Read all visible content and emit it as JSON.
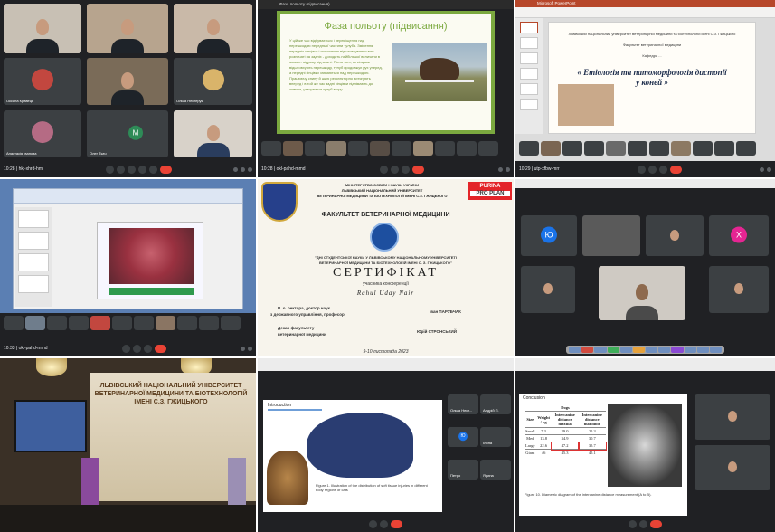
{
  "panel1": {
    "clock": "10:28 | hkj-xhrd-hmi",
    "names": [
      "",
      "",
      "",
      "",
      "",
      "Оксана Кравець",
      "",
      "Ольга Нестерук",
      "Анастасія Іванова",
      "Олег Ткач",
      ""
    ],
    "avatar_letter": "M"
  },
  "panel2": {
    "tab": "Фаза польоту (підвисання)",
    "title": "Фаза польоту (підвисання)",
    "text": "У цій же час відбувається і переміщення над перешкодою передньої частини тулуба. Змінення передніх кінцівок і положення відштовхування вже розпочаті на задніх - доходить найбільшої величини в момент відриву від землі. Після того, як кінцівки відштовхують перешкоду, тулуб продовжує рух уперед, а передні кінцівки згинаються над перешкодою. Працюючу спину й шию рефлекторно витягують вперед і в той же час задні кінцівки піднімають до живота, утворюючи тулуб вгору.",
    "clock": "10:28 | okl-pahd-mmd"
  },
  "panel3": {
    "header": "Microsoft PowerPoint",
    "line1": "Львівський національний університет ветеринарної медицини та біотехнологій імені С.З. Гжицького",
    "line2": "Факультет ветеринарної медицини",
    "line3": "Кафедра ...",
    "big_title": "« Етіологія та патоморфологія дистопії у коней »",
    "clock": "10:29 | utp-xfbw-mrr"
  },
  "panel4": {
    "clock": "10:33 | okl-pahd-mmd"
  },
  "cert": {
    "h1": "МІНІСТЕРСТВО ОСВІТИ І НАУКИ УКРАЇНИ",
    "h2": "ЛЬВІВСЬКИЙ НАЦІОНАЛЬНИЙ УНІВЕРСИТЕТ",
    "h3": "ВЕТЕРИНАРНОЇ МЕДИЦИНИ ТА БІОТЕХНОЛОГІЙ ІМЕНІ С.З. ГЖИЦЬКОГО",
    "purina": "PURINA",
    "proplan": "PRO PLAN",
    "faculty": "ФАКУЛЬТЕТ ВЕТЕРИНАРНОЇ МЕДИЦИНИ",
    "conf1": "\"ДНІ СТУДЕНТСЬКОЇ НАУКИ У ЛЬВІВСЬКОМУ НАЦІОНАЛЬНОМУ УНІВЕРСИТЕТІ",
    "conf2": "ВЕТЕРИНАРНОЇ МЕДИЦИНИ ТА БІОТЕХНОЛОГІЙ ІМЕНІ С. З. ГЖИЦЬКОГО\"",
    "word": "СЕРТИФІКАТ",
    "sub": "учасника конференції",
    "name": "Rahul Uday Nair",
    "left1": "В. о. ректора, доктор наук",
    "left2": "з державного управління, професор",
    "right1": "Іван ПАРУБЧАК",
    "left3": "Декан факультету",
    "left4": "ветеринарної медицини",
    "right2": "Юрій СТРОНСЬКИЙ",
    "date": "9-10 листопада 2023"
  },
  "panel6": {
    "letters": [
      "Ю",
      "X"
    ]
  },
  "panel7": {
    "facade_text": "ЛЬВІВСЬКИЙ НАЦІОНАЛЬНИЙ УНІВЕРСИТЕТ ВЕТЕРИНАРНОЇ МЕДИЦИНИ ТА БІОТЕХНОЛОГІЙ ІМЕНІ С.З. ГЖИЦЬКОГО"
  },
  "panel8": {
    "intro": "Introduction",
    "fig": "Figure 1. Illustration of the distribution of soft tissue injuries in different body regions of cats",
    "names": [
      "Ольга Нест...",
      "Андрій П.",
      "Ю",
      "Ілона",
      "Петро",
      "Ярина"
    ]
  },
  "panel9": {
    "title": "Conclusion",
    "table_title": "Dogs",
    "headers": [
      "Size",
      "Weight / kg",
      "Intercanine distance maxilla",
      "Intercanine distance mandible"
    ],
    "rows": [
      [
        "Small",
        "7.3",
        "29.0",
        "25.3"
      ],
      [
        "Med",
        "13.8",
        "34.9",
        "30.7"
      ],
      [
        "Large",
        "22.6",
        "47.2",
        "35.7"
      ],
      [
        "Giant",
        "46",
        "45.3",
        "45.1"
      ]
    ],
    "caption": "Figure 10. Diametric diagram of the intercanine distance measurement (A to B)."
  }
}
